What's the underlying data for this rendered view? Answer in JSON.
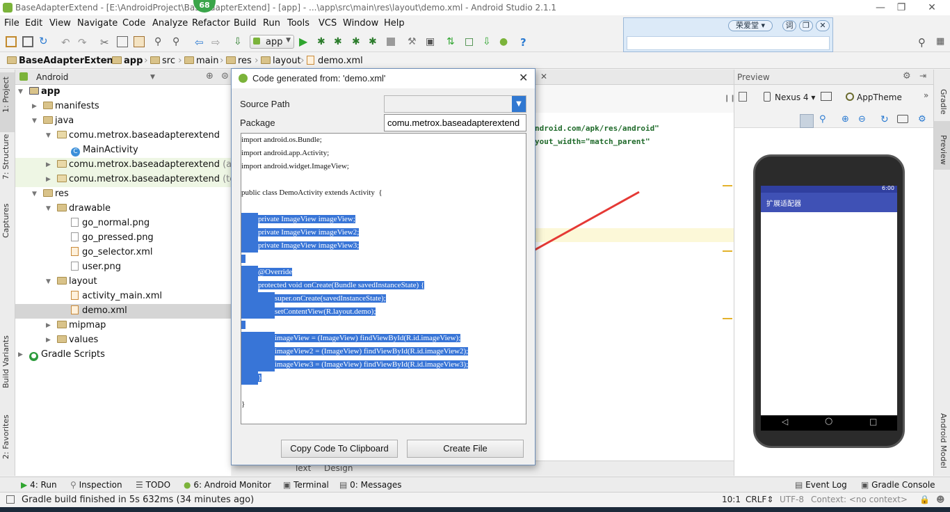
{
  "window": {
    "title": "BaseAdapterExtend - [E:\\AndroidProject\\BaseAdapterExtend] - [app] - ...\\app\\src\\main\\res\\layout\\demo.xml - Android Studio 2.1.1",
    "badge": "68"
  },
  "menu": [
    "File",
    "Edit",
    "View",
    "Navigate",
    "Code",
    "Analyze",
    "Refactor",
    "Build",
    "Run",
    "Tools",
    "VCS",
    "Window",
    "Help"
  ],
  "toolbar": {
    "run_config": "app"
  },
  "ime": {
    "brand": "荣爱堂",
    "word_label": "词"
  },
  "breadcrumb": [
    "BaseAdapterExtend",
    "app",
    "src",
    "main",
    "res",
    "layout",
    "demo.xml"
  ],
  "left_strip": {
    "project": "1: Project",
    "structure": "7: Structure",
    "captures": "Captures",
    "build_variants": "Build Variants",
    "favorites": "2: Favorites"
  },
  "project_panel": {
    "view_mode": "Android",
    "tree": [
      {
        "label": "app",
        "level": 0,
        "kind": "module",
        "expanded": true
      },
      {
        "label": "manifests",
        "level": 1,
        "kind": "folder",
        "expanded": false
      },
      {
        "label": "java",
        "level": 1,
        "kind": "folder",
        "expanded": true
      },
      {
        "label": "comu.metrox.baseadapterextend",
        "level": 2,
        "kind": "package",
        "expanded": true
      },
      {
        "label": "MainActivity",
        "level": 3,
        "kind": "class"
      },
      {
        "label": "comu.metrox.baseadapterextend",
        "suffix": "(andr",
        "level": 2,
        "kind": "package",
        "expanded": false
      },
      {
        "label": "comu.metrox.baseadapterextend",
        "suffix": "(test)",
        "level": 2,
        "kind": "package",
        "expanded": false
      },
      {
        "label": "res",
        "level": 1,
        "kind": "folder",
        "expanded": true
      },
      {
        "label": "drawable",
        "level": 2,
        "kind": "folder",
        "expanded": true
      },
      {
        "label": "go_normal.png",
        "level": 3,
        "kind": "file"
      },
      {
        "label": "go_pressed.png",
        "level": 3,
        "kind": "file"
      },
      {
        "label": "go_selector.xml",
        "level": 3,
        "kind": "xml"
      },
      {
        "label": "user.png",
        "level": 3,
        "kind": "file"
      },
      {
        "label": "layout",
        "level": 2,
        "kind": "folder",
        "expanded": true
      },
      {
        "label": "activity_main.xml",
        "level": 3,
        "kind": "xml"
      },
      {
        "label": "demo.xml",
        "level": 3,
        "kind": "xml",
        "selected": true
      },
      {
        "label": "mipmap",
        "level": 2,
        "kind": "folder",
        "expanded": false
      },
      {
        "label": "values",
        "level": 2,
        "kind": "folder",
        "expanded": false
      },
      {
        "label": "Gradle Scripts",
        "level": 0,
        "kind": "gradle",
        "expanded": false
      }
    ]
  },
  "editor": {
    "line1": "ndroid.com/apk/res/android\"",
    "line2": "yout_width=\"match_parent\"",
    "tabs": [
      "Text",
      "Design"
    ]
  },
  "dialog": {
    "title": "Code generated from: 'demo.xml'",
    "source_path_label": "Source Path",
    "source_path_value": "",
    "package_label": "Package",
    "package_value": "comu.metrox.baseadapterextend",
    "code_lines": [
      {
        "text": "import android.os.Bundle;",
        "indent": 0,
        "selected": false
      },
      {
        "text": "import android.app.Activity;",
        "indent": 0,
        "selected": false
      },
      {
        "text": "import android.widget.ImageView;",
        "indent": 0,
        "selected": false
      },
      {
        "text": "",
        "indent": 0,
        "selected": false
      },
      {
        "text": "public class DemoActivity extends Activity  {",
        "indent": 0,
        "selected": false
      },
      {
        "text": "",
        "indent": 0,
        "selected": false
      },
      {
        "text": "private ImageView imageView;",
        "indent": 1,
        "selected": true
      },
      {
        "text": "private ImageView imageView2;",
        "indent": 1,
        "selected": true
      },
      {
        "text": "private ImageView imageView3;",
        "indent": 1,
        "selected": true
      },
      {
        "text": "",
        "indent": 0,
        "selected": true
      },
      {
        "text": "@Override",
        "indent": 1,
        "selected": true
      },
      {
        "text": "protected void onCreate(Bundle savedInstanceState) {",
        "indent": 1,
        "selected": true
      },
      {
        "text": "super.onCreate(savedInstanceState);",
        "indent": 2,
        "selected": true
      },
      {
        "text": "setContentView(R.layout.demo);",
        "indent": 2,
        "selected": true
      },
      {
        "text": "",
        "indent": 0,
        "selected": true
      },
      {
        "text": "imageView = (ImageView) findViewById(R.id.imageView);",
        "indent": 2,
        "selected": true
      },
      {
        "text": "imageView2 = (ImageView) findViewById(R.id.imageView2);",
        "indent": 2,
        "selected": true
      },
      {
        "text": "imageView3 = (ImageView) findViewById(R.id.imageView3);",
        "indent": 2,
        "selected": true
      },
      {
        "text": "}",
        "indent": 1,
        "selected": true
      },
      {
        "text": "",
        "indent": 0,
        "selected": false
      },
      {
        "text": "}",
        "indent": 0,
        "selected": false
      }
    ],
    "copy_button": "Copy Code To Clipboard",
    "create_button": "Create File"
  },
  "preview": {
    "header": "Preview",
    "device": "Nexus 4",
    "theme": "AppTheme",
    "phone_time": "6:00",
    "app_title": "扩展适配器"
  },
  "right_strip": {
    "gradle": "Gradle",
    "preview": "Preview",
    "android_model": "Android Model"
  },
  "bottom_tabs": [
    "4: Run",
    "Inspection",
    "TODO",
    "6: Android Monitor",
    "Terminal",
    "0: Messages"
  ],
  "bottom_right_tabs": [
    "Event Log",
    "Gradle Console"
  ],
  "status": {
    "message": "Gradle build finished in 5s 632ms (34 minutes ago)",
    "position": "10:1",
    "line_sep": "CRLF",
    "encoding": "UTF-8",
    "context": "Context: <no context>"
  },
  "colors": {
    "selection": "#3875d7",
    "accent_green": "#3aa54a",
    "app_bar": "#3f51b5"
  }
}
